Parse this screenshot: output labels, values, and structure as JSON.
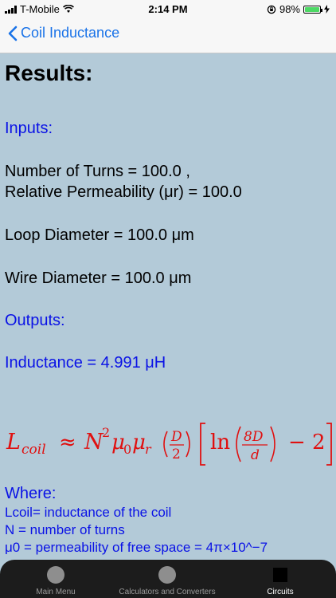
{
  "status_bar": {
    "carrier": "T-Mobile",
    "time": "2:14 PM",
    "battery": "98%",
    "battery_level": 0.98
  },
  "nav": {
    "back_label": "Coil Inductance"
  },
  "results": {
    "title": "Results:",
    "inputs_label": "Inputs:",
    "turns": "Number of Turns = 100.0 ,",
    "permeability": "Relative Permeability (μr) = 100.0",
    "loop_diameter": "Loop Diameter  = 100.0 μm",
    "wire_diameter": "Wire Diameter = 100.0 μm",
    "outputs_label": "Outputs:",
    "inductance": "Inductance = 4.991 μH"
  },
  "formula": {
    "L": "L",
    "coil": "coil",
    "approx": "≈",
    "N": "N",
    "two": "2",
    "mu": "μ",
    "zero": "0",
    "r": "r",
    "D": "D",
    "ln": "ln",
    "eightD": "8D",
    "d": "d",
    "minus": "−",
    "minus_two": "2"
  },
  "where": {
    "label": "Where:",
    "lcoil": "Lcoil= inductance of the coil",
    "n": "N = number of turns",
    "mu0": "μ0 = permeability of free space = 4π×10^−7"
  },
  "tabs": [
    {
      "label": "Main Menu",
      "icon": "circle-icon"
    },
    {
      "label": "Calculators and Converters",
      "icon": "circle-icon"
    },
    {
      "label": "Circuits",
      "icon": "square-icon"
    }
  ],
  "colors": {
    "background": "#b3cad8",
    "accent_blue": "#0a12e6",
    "formula_red": "#e01010",
    "nav_blue": "#1a73e8"
  }
}
